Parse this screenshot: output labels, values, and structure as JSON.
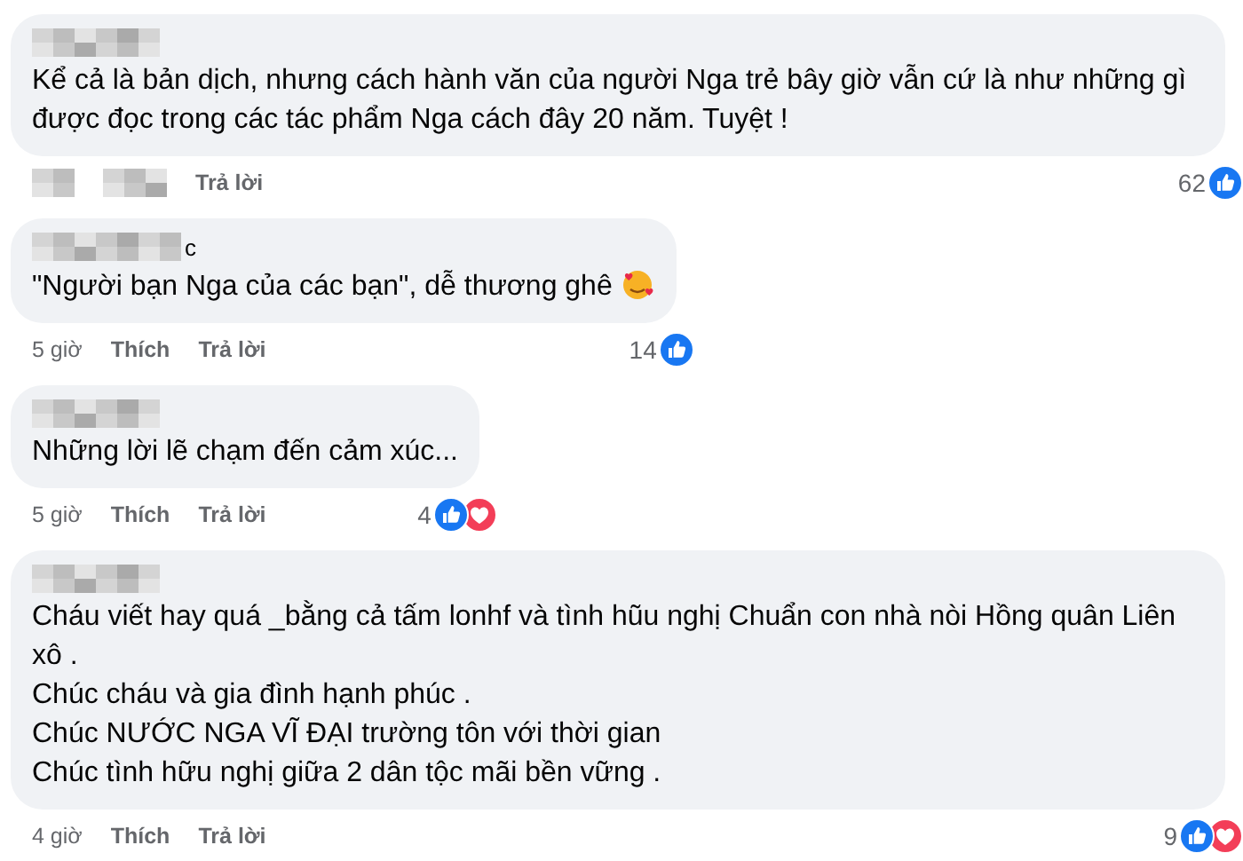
{
  "comments": [
    {
      "lines": [
        "Kể cả là bản dịch, nhưng cách hành văn của người Nga trẻ bây giờ vẫn cứ là như những gì được đọc trong các tác phẩm Nga cách đây 20 năm. Tuyệt !"
      ],
      "reply_label": "Trả lời",
      "reaction_count": "62",
      "reactions": [
        {
          "kind": "like"
        }
      ]
    },
    {
      "name_tail": "c",
      "lines": [
        "\"Người bạn Nga của các bạn\", dễ thương ghê"
      ],
      "emoji": {
        "kind": "care"
      },
      "time": "5 giờ",
      "like_label": "Thích",
      "reply_label": "Trả lời",
      "reaction_count": "14",
      "reactions": [
        {
          "kind": "like"
        }
      ]
    },
    {
      "lines": [
        "Những lời lẽ chạm đến cảm xúc..."
      ],
      "time": "5 giờ",
      "like_label": "Thích",
      "reply_label": "Trả lời",
      "reaction_count": "4",
      "reactions": [
        {
          "kind": "like"
        },
        {
          "kind": "love"
        }
      ]
    },
    {
      "lines": [
        "Cháu viết hay quá _bằng cả tấm lonhf và tình hũu nghị Chuẩn con nhà nòi Hồng quân Liên xô .",
        "Chúc cháu và gia đình hạnh phúc .",
        "Chúc NƯỚC NGA VĨ ĐẠI trường tôn với thời gian",
        "Chúc tình hữu nghị giữa 2 dân tộc mãi bền vững ."
      ],
      "time": "4 giờ",
      "like_label": "Thích",
      "reply_label": "Trả lời",
      "reaction_count": "9",
      "reactions": [
        {
          "kind": "like"
        },
        {
          "kind": "love"
        }
      ]
    }
  ]
}
